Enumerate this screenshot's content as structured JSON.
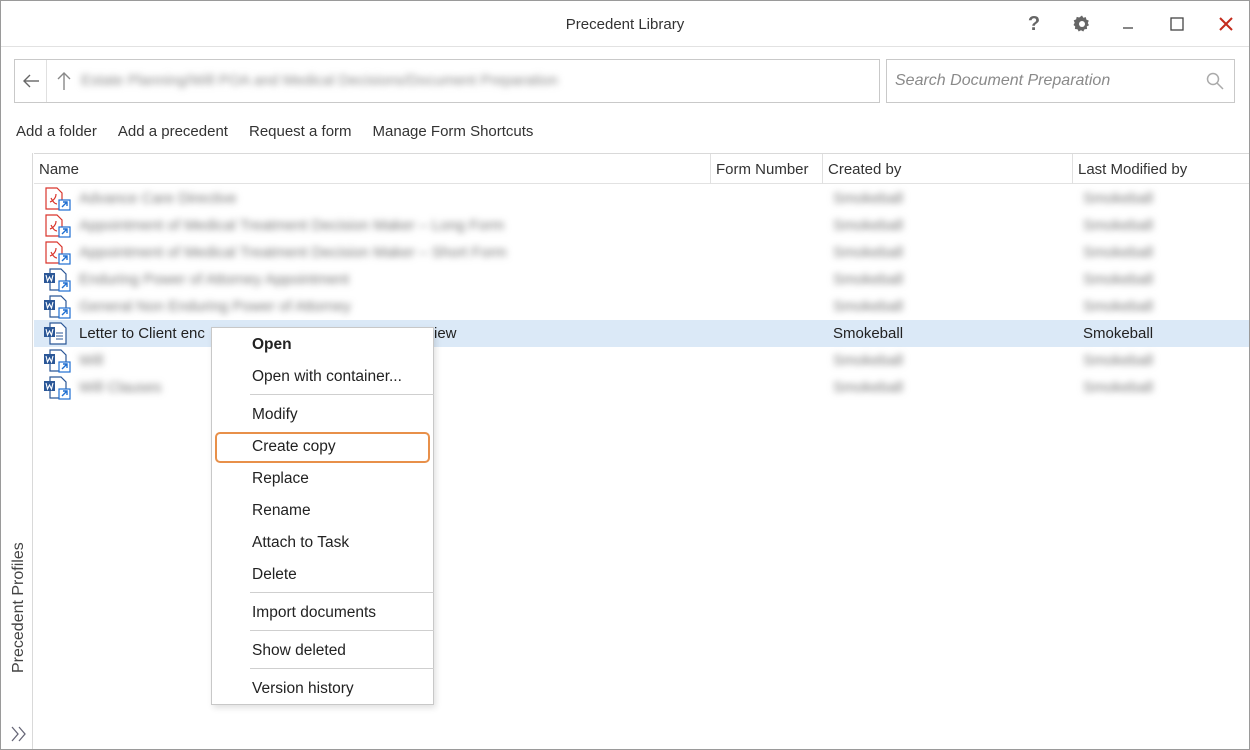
{
  "window": {
    "title": "Precedent Library"
  },
  "titlebar": {
    "help_glyph": "?"
  },
  "address": {
    "path": "Estate Planning/Will POA and Medical Decisions/Document Preparation"
  },
  "search": {
    "placeholder": "Search Document Preparation"
  },
  "toolbar": {
    "add_folder": "Add a folder",
    "add_precedent": "Add a precedent",
    "request_form": "Request a form",
    "manage_shortcuts": "Manage Form Shortcuts"
  },
  "sidepanel": {
    "label": "Precedent Profiles"
  },
  "grid": {
    "columns": {
      "name": "Name",
      "form_number": "Form Number",
      "created_by": "Created by",
      "last_modified_by": "Last Modified by"
    },
    "rows": [
      {
        "icon": "pdf-shortcut-icon",
        "name": "Advance Care Directive",
        "created_by": "Smokeball",
        "modified_by": "Smokeball"
      },
      {
        "icon": "pdf-shortcut-icon",
        "name": "Appointment of Medical Treatment Decision Maker – Long Form",
        "created_by": "Smokeball",
        "modified_by": "Smokeball"
      },
      {
        "icon": "pdf-shortcut-icon",
        "name": "Appointment of Medical Treatment Decision Maker – Short Form",
        "created_by": "Smokeball",
        "modified_by": "Smokeball"
      },
      {
        "icon": "word-shortcut-icon",
        "name": "Enduring Power of Attorney Appointment",
        "created_by": "Smokeball",
        "modified_by": "Smokeball"
      },
      {
        "icon": "word-shortcut-icon",
        "name": "General Non Enduring Power of Attorney",
        "created_by": "Smokeball",
        "modified_by": "Smokeball"
      },
      {
        "icon": "word-doc-icon",
        "name": "Letter to Client enclosing draft documents for review",
        "visible_name_start": "Letter to Client enc",
        "visible_name_end": "iew",
        "created_by": "Smokeball",
        "modified_by": "Smokeball"
      },
      {
        "icon": "word-shortcut-icon",
        "name": "Will",
        "created_by": "Smokeball",
        "modified_by": "Smokeball"
      },
      {
        "icon": "word-shortcut-icon",
        "name": "Will Clauses",
        "created_by": "Smokeball",
        "modified_by": "Smokeball"
      }
    ]
  },
  "context_menu": {
    "open": "Open",
    "open_container": "Open with container...",
    "modify": "Modify",
    "create_copy": "Create copy",
    "replace": "Replace",
    "rename": "Rename",
    "attach_task": "Attach to Task",
    "delete": "Delete",
    "import_documents": "Import documents",
    "show_deleted": "Show deleted",
    "version_history": "Version history"
  },
  "colors": {
    "selected_row": "#dbe9f7",
    "highlight_border": "#e8904a",
    "close_red": "#c42b1c",
    "pdf_red": "#d9352c",
    "word_blue": "#2b5797",
    "shortcut_blue": "#1f6fd1"
  }
}
